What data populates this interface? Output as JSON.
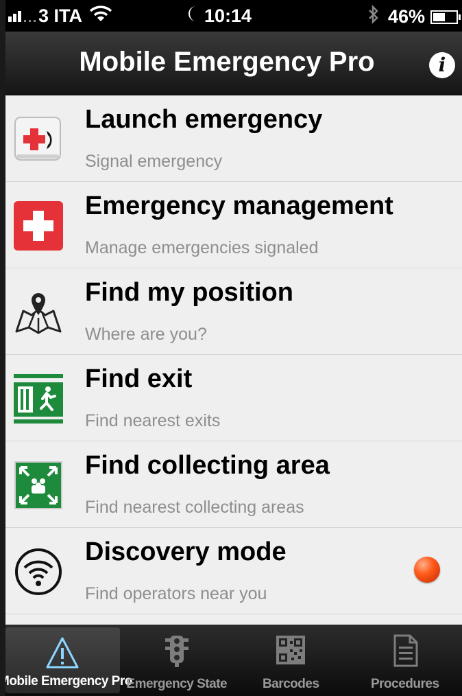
{
  "status_bar": {
    "carrier": "3 ITA",
    "time": "10:14",
    "battery": "46%",
    "battery_level": 0.46,
    "icons": [
      "signal-bars-icon",
      "wifi-icon",
      "moon-icon",
      "bluetooth-icon",
      "battery-icon"
    ]
  },
  "nav": {
    "title": "Mobile Emergency Pro",
    "info_icon": "info-icon"
  },
  "menu": {
    "items": [
      {
        "title": "Launch emergency",
        "subtitle": "Signal emergency",
        "icon": "emergency-phone-icon"
      },
      {
        "title": "Emergency management",
        "subtitle": "Manage emergencies signaled",
        "icon": "red-cross-icon"
      },
      {
        "title": "Find my position",
        "subtitle": "Where are you?",
        "icon": "map-pin-icon"
      },
      {
        "title": "Find exit",
        "subtitle": "Find nearest exits",
        "icon": "exit-sign-icon"
      },
      {
        "title": "Find collecting area",
        "subtitle": "Find nearest collecting areas",
        "icon": "assembly-point-icon"
      },
      {
        "title": "Discovery mode",
        "subtitle": "Find operators near you",
        "icon": "wifi-circle-icon",
        "status_color": "#ff5a1a"
      }
    ]
  },
  "tabs": [
    {
      "label": "Mobile Emergency Pro",
      "icon": "warning-triangle-icon",
      "active": true
    },
    {
      "label": "Emergency State",
      "icon": "traffic-light-icon",
      "active": false
    },
    {
      "label": "Barcodes",
      "icon": "qr-code-icon",
      "active": false
    },
    {
      "label": "Procedures",
      "icon": "document-icon",
      "active": false
    }
  ],
  "colors": {
    "red": "#e53238",
    "green": "#1e8a3c",
    "tab_active_icon": "#8ad6ff"
  }
}
